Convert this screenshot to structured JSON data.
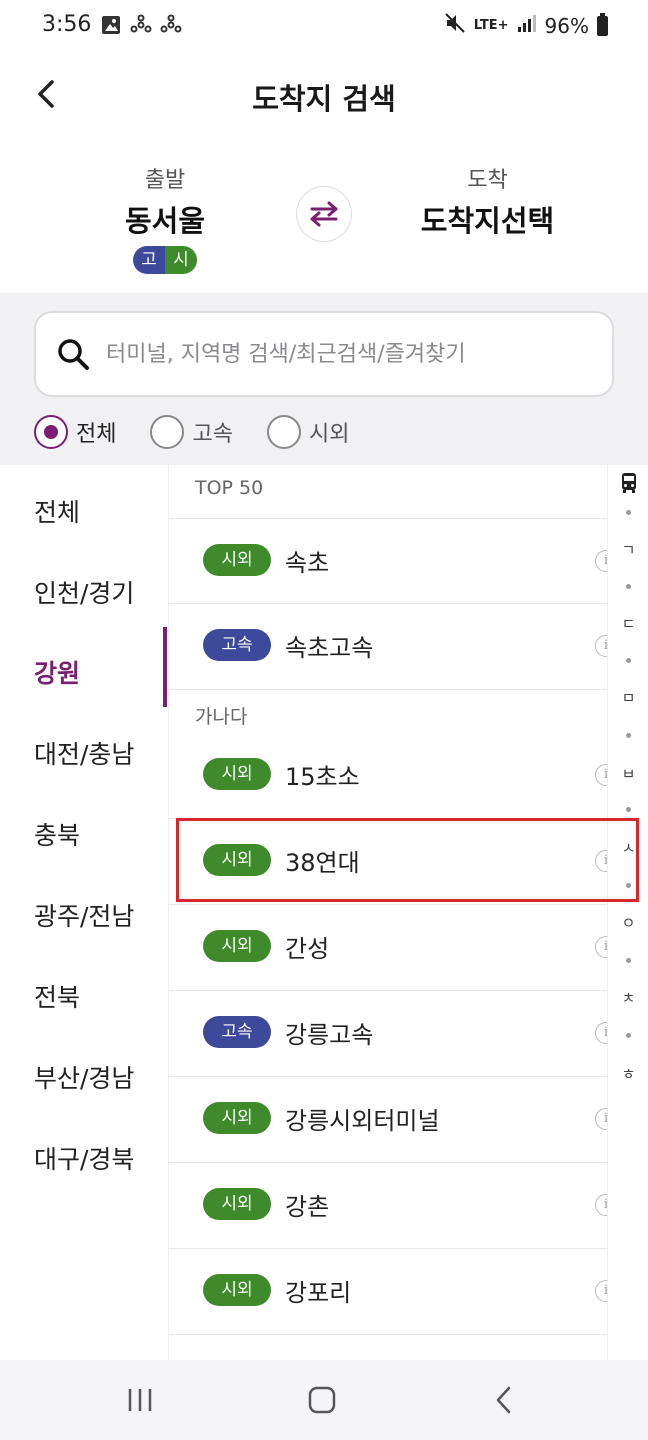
{
  "status_bar": {
    "time": "3:56",
    "lte": "LTE+",
    "battery": "96%",
    "icons": [
      "gallery-icon",
      "fan-icon",
      "fan-icon",
      "mute-icon",
      "signal-icon",
      "battery-icon"
    ]
  },
  "header": {
    "title": "도착지 검색",
    "back_icon": "chevron-left-icon"
  },
  "route": {
    "origin_caption": "출발",
    "origin_name": "동서울",
    "origin_badges": [
      "고",
      "시"
    ],
    "dest_caption": "도착",
    "dest_name": "도착지선택",
    "swap_icon": "swap-arrows-icon"
  },
  "search": {
    "placeholder": "터미널, 지역명 검색/최근검색/즐겨찾기",
    "value": ""
  },
  "filters": [
    {
      "label": "전체",
      "checked": true
    },
    {
      "label": "고속",
      "checked": false
    },
    {
      "label": "시외",
      "checked": false
    }
  ],
  "regions": [
    {
      "label": "전체"
    },
    {
      "label": "인천/경기"
    },
    {
      "label": "강원",
      "active": true
    },
    {
      "label": "대전/충남"
    },
    {
      "label": "충북"
    },
    {
      "label": "광주/전남"
    },
    {
      "label": "전북"
    },
    {
      "label": "부산/경남"
    },
    {
      "label": "대구/경북"
    }
  ],
  "sections": {
    "top": "TOP 50",
    "ganada": "가나다"
  },
  "terminals": [
    {
      "type": "시외",
      "name": "속초"
    },
    {
      "type": "고속",
      "name": "속초고속"
    },
    {
      "type": "시외",
      "name": "15초소"
    },
    {
      "type": "시외",
      "name": "38연대",
      "highlighted": true
    },
    {
      "type": "시외",
      "name": "간성"
    },
    {
      "type": "고속",
      "name": "강릉고속"
    },
    {
      "type": "시외",
      "name": "강릉시외터미널"
    },
    {
      "type": "시외",
      "name": "강촌"
    },
    {
      "type": "시외",
      "name": "강포리"
    }
  ],
  "info_glyph": "i",
  "index_rail": {
    "top_icon": "bus-icon",
    "letters": [
      "ㄱ",
      "ㄷ",
      "ㅁ",
      "ㅂ",
      "ㅅ",
      "ㅇ",
      "ㅊ",
      "ㅎ"
    ]
  },
  "colors": {
    "accent": "#7a1f72",
    "express_badge": "#3d4a9c",
    "intercity_badge": "#3f8b2c",
    "highlight": "#d9262c"
  },
  "nav": {
    "recent_icon": "recent-apps-icon",
    "home_icon": "home-icon",
    "back_icon": "back-icon"
  }
}
